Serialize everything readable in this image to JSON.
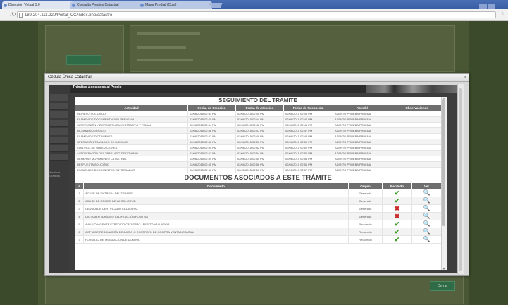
{
  "browser": {
    "tabs": [
      {
        "title": "Dirección Virtual 3.0"
      },
      {
        "title": "Consulta Predios Catastral"
      },
      {
        "title": "Mapa Predial (Cual)"
      }
    ],
    "url": "189.204.111.229/Portal_CC/index.php/catastro"
  },
  "modal": {
    "title": "Cédula Única Catastral",
    "close": "×",
    "header_label": "Trámites Asociados al Predio",
    "sidebar_label": "Archivos Gráficos",
    "tracking": {
      "title": "SEGUIMIENTO DEL TRAMITE",
      "columns": [
        "Actividad",
        "Fecha de Creación",
        "Fecha de Atención",
        "Fecha de Respuesta",
        "Atendió",
        "Observaciones"
      ],
      "rows": [
        [
          "INGRESO SOLICITUD",
          "02/08/2015 02:33 PM",
          "02/08/2015 02:40 PM",
          "02/08/2015 02:40 PM",
          "ASENTO PRUEBA PRUEBA",
          ""
        ],
        [
          "EXAMEN DE DOCUMENTACIÓN PREVENIA",
          "02/08/2015 02:40 PM",
          "02/08/2015 02:44 PM",
          "02/08/2015 02:44 PM",
          "ASENTO PRUEBA PRUEBA",
          ""
        ],
        [
          "SUPERVISIÓN Y DICTAMEN ADMINISTRATIVO Y FISCAL",
          "02/08/2015 02:44 PM",
          "02/08/2015 02:46 PM",
          "02/08/2015 02:46 PM",
          "ASENTO PRUEBA PRUEBA",
          ""
        ],
        [
          "DICTAMEN JURÍDICO",
          "02/08/2015 02:46 PM",
          "02/08/2015 02:47 PM",
          "02/08/2015 02:47 PM",
          "ASENTO PRUEBA PRUEBA",
          ""
        ],
        [
          "EXAMEN DE DICTAMENES",
          "02/08/2015 02:47 PM",
          "02/08/2015 02:48 PM",
          "02/08/2015 02:48 PM",
          "ASENTO PRUEBA PRUEBA",
          ""
        ],
        [
          "OPERACIÓN TRASLADO DE DOMINIO",
          "02/08/2015 02:48 PM",
          "02/08/2015 02:50 PM",
          "02/08/2015 02:50 PM",
          "ASENTO PRUEBA PRUEBA",
          ""
        ],
        [
          "CONTROL DE OBLIGACIONES",
          "02/08/2015 02:50 PM",
          "02/08/2015 02:52 PM",
          "02/08/2015 02:52 PM",
          "ASENTO PRUEBA PRUEBA",
          ""
        ],
        [
          "AUTORIZACIÓN DEL TRASLADO DE DOMINIO",
          "02/08/2015 02:52 PM",
          "02/08/2015 02:54 PM",
          "02/08/2015 02:54 PM",
          "ASENTO PRUEBA PRUEBA",
          ""
        ],
        [
          "GENERAR MOVIMIENTO CATASTRAL",
          "02/08/2015 02:54 PM",
          "02/08/2015 02:55 PM",
          "02/08/2015 02:55 PM",
          "ASENTO PRUEBA PRUEBA",
          ""
        ],
        [
          "RESPUESTA SOLICITUD",
          "02/08/2015 02:55 PM",
          "02/08/2015 02:56 PM",
          "02/08/2015 02:56 PM",
          "ASENTO PRUEBA PRUEBA",
          ""
        ],
        [
          "EXAMEN DE DOCUMENTOS ENTREGADOS",
          "02/08/2015 02:56 PM",
          "02/08/2015 02:57 PM",
          "02/08/2015 02:57 PM",
          "ASENTO PRUEBA PRUEBA",
          ""
        ]
      ]
    },
    "documents": {
      "title": "DOCUMENTOS ASOCIADOS A ESTE TRÁMITE",
      "columns": [
        "#",
        "Documento",
        "Origen",
        "Recibido",
        "Ver"
      ],
      "rows": [
        {
          "n": "1",
          "doc": "ACUSE DE ENTREGA DEL TRÁMITE",
          "origin": "Generado",
          "received": "ok"
        },
        {
          "n": "2",
          "doc": "ACUSE DE RECIBO DE LA SOLICITUD",
          "origin": "Generado",
          "received": "ok"
        },
        {
          "n": "3",
          "doc": "CEDULA DE CERTIFICADO CATASTRAL",
          "origin": "Generado",
          "received": "no"
        },
        {
          "n": "4",
          "doc": "DICTAMEN JURÍDICO CALIFICACIÓN POSITIVA",
          "origin": "Generado",
          "received": "no"
        },
        {
          "n": "5",
          "doc": "AVALÚO VIGENTE EXPEDIDO CATASTRO / PERITO VALUADOR",
          "origin": "Requerido",
          "received": "ok"
        },
        {
          "n": "6",
          "doc": "COPIA DE RESOLUCIÓN DE JUICIO O CONTRATO DE COMPRA VENTA NOTARIAL",
          "origin": "Requerido",
          "received": "ok"
        },
        {
          "n": "7",
          "doc": "FORMATO DE TRASLACIÓN DE DOMINIO",
          "origin": "Requerido",
          "received": "ok"
        }
      ],
      "received_icons": {
        "ok": "✔",
        "no": "✖"
      },
      "view_icon": "🔍"
    }
  },
  "footer": {
    "button": "Cerrar"
  },
  "colors": {
    "ok": "#3c9a25",
    "no": "#c92c2c",
    "header": "#6e6e6e"
  }
}
